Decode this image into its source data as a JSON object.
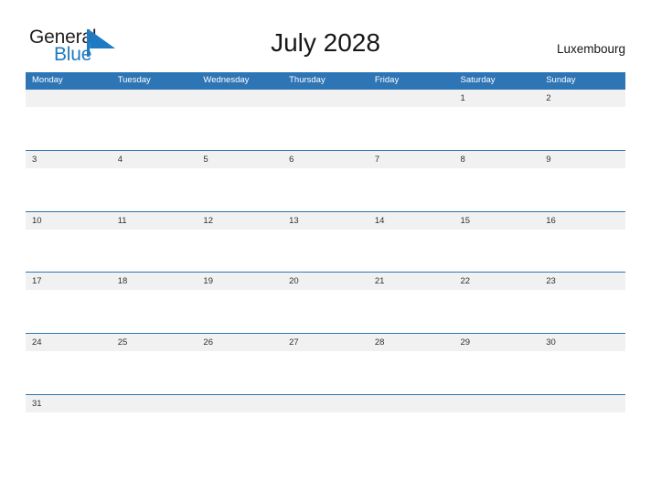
{
  "brand": {
    "line1": "General",
    "line2": "Blue",
    "flag_icon": "blue-triangle-flag-icon",
    "color_dark": "#231f20",
    "color_blue": "#1f7bc1"
  },
  "header": {
    "title": "July 2028",
    "locale": "Luxembourg"
  },
  "colors": {
    "header_blue": "#2e75b6",
    "row_band_gray": "#f1f1f1",
    "text_dark": "#313131",
    "page_background": "#ffffff"
  },
  "calendar": {
    "month": "July",
    "year": "2028",
    "weekday_headers": [
      "Monday",
      "Tuesday",
      "Wednesday",
      "Thursday",
      "Friday",
      "Saturday",
      "Sunday"
    ],
    "weeks": [
      [
        "",
        "",
        "",
        "",
        "",
        "1",
        "2"
      ],
      [
        "3",
        "4",
        "5",
        "6",
        "7",
        "8",
        "9"
      ],
      [
        "10",
        "11",
        "12",
        "13",
        "14",
        "15",
        "16"
      ],
      [
        "17",
        "18",
        "19",
        "20",
        "21",
        "22",
        "23"
      ],
      [
        "24",
        "25",
        "26",
        "27",
        "28",
        "29",
        "30"
      ],
      [
        "31",
        "",
        "",
        "",
        "",
        "",
        ""
      ]
    ]
  }
}
